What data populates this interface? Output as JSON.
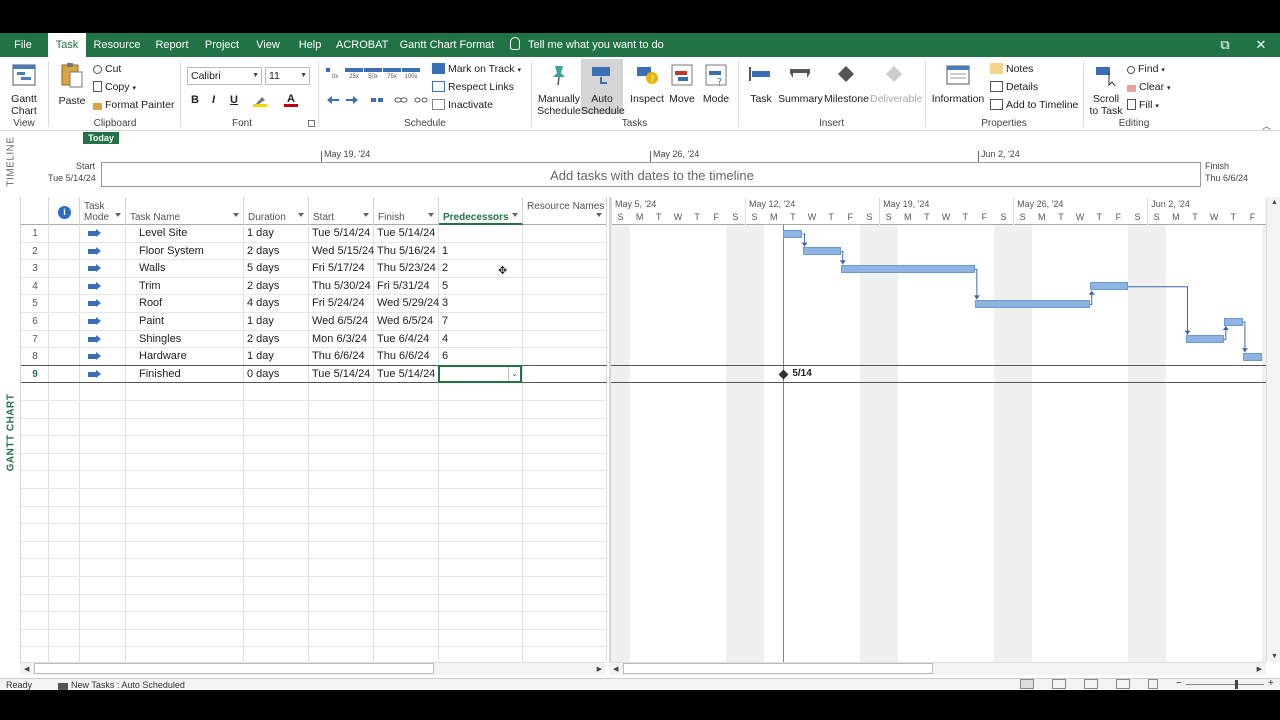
{
  "tabs": {
    "file": "File",
    "task": "Task",
    "resource": "Resource",
    "report": "Report",
    "project": "Project",
    "view": "View",
    "help": "Help",
    "acrobat": "ACROBAT",
    "gantt_format": "Gantt Chart Format",
    "tell_me": "Tell me what you want to do"
  },
  "ribbon": {
    "view": {
      "gantt_chart": "Gantt Chart",
      "label": "View"
    },
    "clipboard": {
      "paste": "Paste",
      "cut": "Cut",
      "copy": "Copy",
      "format_painter": "Format Painter",
      "label": "Clipboard"
    },
    "font": {
      "family": "Calibri",
      "size": "11",
      "bold": "B",
      "italic": "I",
      "underline": "U",
      "label": "Font"
    },
    "schedule": {
      "mark_on_track": "Mark on Track",
      "respect_links": "Respect Links",
      "inactivate": "Inactivate",
      "label": "Schedule",
      "pct": [
        "0x",
        "25x",
        "50x",
        "75x",
        "100x"
      ]
    },
    "tasks": {
      "manually": "Manually Schedule",
      "auto": "Auto Schedule",
      "inspect": "Inspect",
      "move": "Move",
      "mode": "Mode",
      "label": "Tasks"
    },
    "insert": {
      "task": "Task",
      "summary": "Summary",
      "milestone": "Milestone",
      "deliverable": "Deliverable",
      "label": "Insert"
    },
    "properties": {
      "information": "Information",
      "notes": "Notes",
      "details": "Details",
      "add_to_timeline": "Add to Timeline",
      "label": "Properties"
    },
    "editing": {
      "scroll_to_task": "Scroll to Task",
      "find": "Find",
      "clear": "Clear",
      "fill": "Fill",
      "label": "Editing"
    }
  },
  "timeline": {
    "side_label": "TIMELINE",
    "today": "Today",
    "start_label": "Start",
    "start_date": "Tue 5/14/24",
    "finish_label": "Finish",
    "finish_date": "Thu 6/6/24",
    "placeholder": "Add tasks with dates to the timeline",
    "dates": [
      "May 19, '24",
      "May 26, '24",
      "Jun 2, '24"
    ]
  },
  "gantt": {
    "side_label": "GANTT CHART",
    "columns": [
      "Task Mode",
      "Task Name",
      "Duration",
      "Start",
      "Finish",
      "Predecessors",
      "Resource Names"
    ],
    "tasks": [
      {
        "id": "1",
        "name": "Level Site",
        "duration": "1 day",
        "start": "Tue 5/14/24",
        "finish": "Tue 5/14/24",
        "pred": ""
      },
      {
        "id": "2",
        "name": "Floor System",
        "duration": "2 days",
        "start": "Wed 5/15/24",
        "finish": "Thu 5/16/24",
        "pred": "1"
      },
      {
        "id": "3",
        "name": "Walls",
        "duration": "5 days",
        "start": "Fri 5/17/24",
        "finish": "Thu 5/23/24",
        "pred": "2"
      },
      {
        "id": "4",
        "name": "Trim",
        "duration": "2 days",
        "start": "Thu 5/30/24",
        "finish": "Fri 5/31/24",
        "pred": "5"
      },
      {
        "id": "5",
        "name": "Roof",
        "duration": "4 days",
        "start": "Fri 5/24/24",
        "finish": "Wed 5/29/24",
        "pred": "3"
      },
      {
        "id": "6",
        "name": "Paint",
        "duration": "1 day",
        "start": "Wed 6/5/24",
        "finish": "Wed 6/5/24",
        "pred": "7"
      },
      {
        "id": "7",
        "name": "Shingles",
        "duration": "2 days",
        "start": "Mon 6/3/24",
        "finish": "Tue 6/4/24",
        "pred": "4"
      },
      {
        "id": "8",
        "name": "Hardware",
        "duration": "1 day",
        "start": "Thu 6/6/24",
        "finish": "Thu 6/6/24",
        "pred": "6"
      },
      {
        "id": "9",
        "name": "Finished",
        "duration": "0 days",
        "start": "Tue 5/14/24",
        "finish": "Tue 5/14/24",
        "pred": ""
      }
    ],
    "chart_weeks": [
      "May 5, '24",
      "May 12, '24",
      "May 19, '24",
      "May 26, '24",
      "Jun 2, '24"
    ],
    "day_letters": [
      "S",
      "M",
      "T",
      "W",
      "T",
      "F",
      "S"
    ],
    "milestone_label": "5/14"
  },
  "status": {
    "ready": "Ready",
    "new_tasks": "New Tasks : Auto Scheduled"
  },
  "colors": {
    "accent": "#217346",
    "bar": "#8db4e2",
    "link": "#3a6aa8"
  }
}
